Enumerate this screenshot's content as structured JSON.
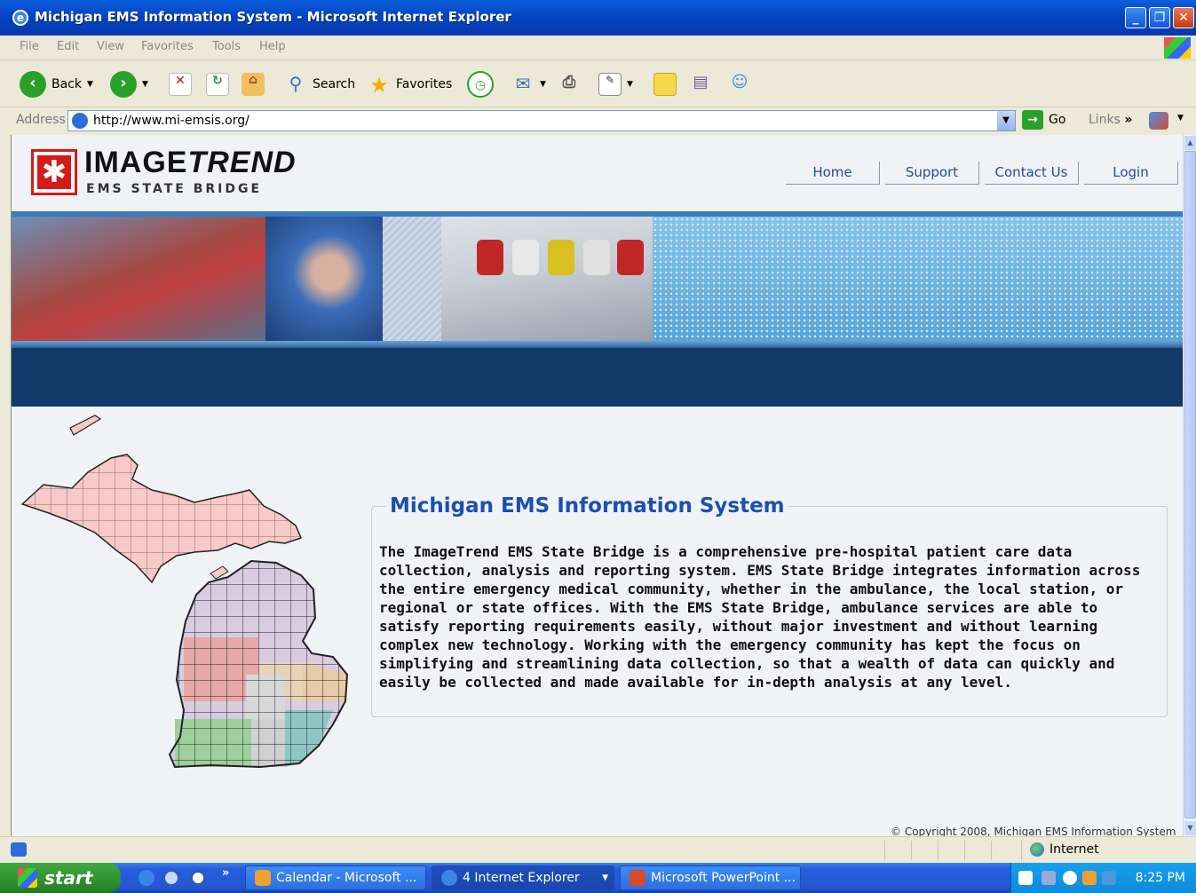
{
  "window": {
    "title": "Michigan EMS Information System - Microsoft Internet Explorer",
    "buttons": {
      "minimize": "_",
      "restore": "❐",
      "close": "✕"
    }
  },
  "menu": [
    "File",
    "Edit",
    "View",
    "Favorites",
    "Tools",
    "Help"
  ],
  "toolbar": {
    "back_label": "Back",
    "search_label": "Search",
    "favorites_label": "Favorites"
  },
  "address": {
    "label": "Address",
    "url": "http://www.mi-emsis.org/",
    "go_label": "Go",
    "links_label": "Links",
    "links_chevron": "»"
  },
  "site": {
    "logo_name_part1": "IMAGE",
    "logo_name_part2": "TREND",
    "logo_sub": "EMS STATE BRIDGE",
    "nav": [
      "Home",
      "Support",
      "Contact Us",
      "Login"
    ],
    "panel_title": "Michigan EMS Information System",
    "panel_body": "The ImageTrend EMS State Bridge is a comprehensive pre-hospital patient care data collection, analysis and reporting system. EMS State Bridge integrates information across the entire emergency medical community, whether in the ambulance, the local station, or regional or state offices. With the EMS State Bridge, ambulance services are able to satisfy reporting requirements easily, without major investment and without learning complex new technology. Working with the emergency community has kept the focus on simplifying and streamlining data collection, so that a wealth of data can quickly and easily be collected and made available for in-depth analysis at any level.",
    "copyright": "© Copyright 2008, Michigan EMS Information System"
  },
  "statusbar": {
    "zone": "Internet"
  },
  "taskbar": {
    "start": "start",
    "chevron": "»",
    "tasks": [
      "Calendar - Microsoft ...",
      "4 Internet Explorer",
      "Microsoft PowerPoint ..."
    ],
    "clock": "8:25 PM"
  },
  "colors": {
    "title_blue": "#0546C4",
    "link_blue": "#1c4e98",
    "heading_blue": "#1a4fb4",
    "logo_red": "#d61a1a",
    "banner_navy": "#123a68"
  }
}
